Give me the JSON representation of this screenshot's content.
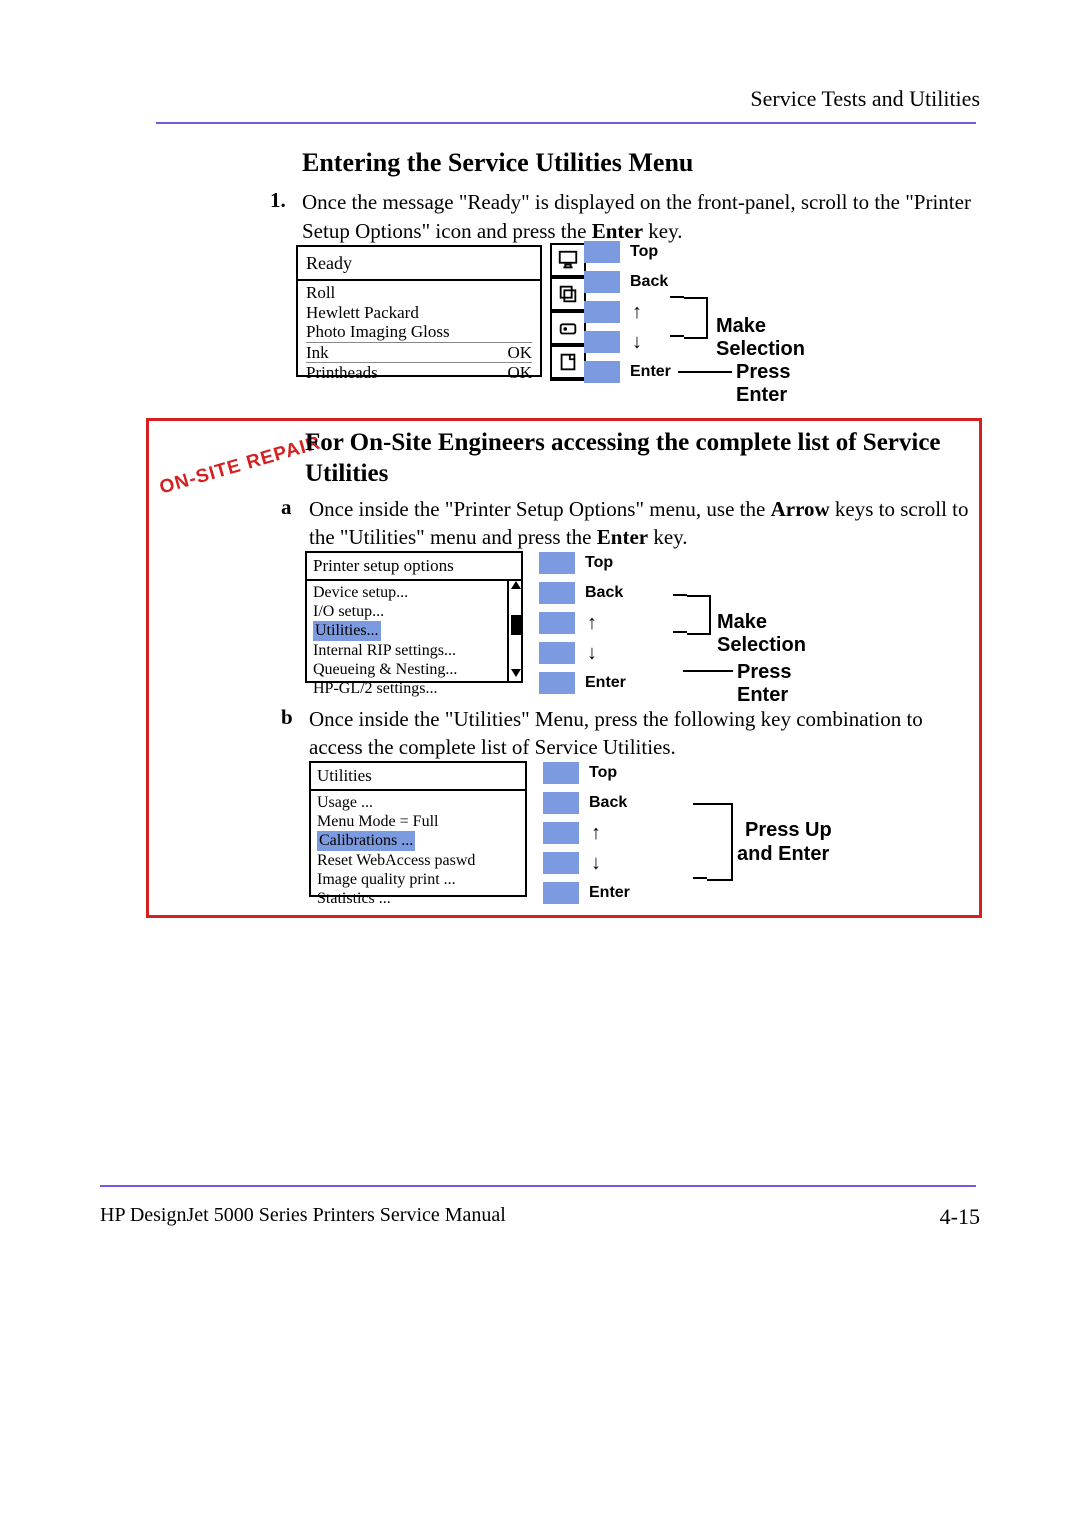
{
  "header": {
    "chapter": "Service Tests and Utilities"
  },
  "section_title": "Entering the Service Utilities Menu",
  "step1": {
    "num": "1.",
    "text_a": "Once the message \"Ready\" is displayed on the front-panel, scroll to the \"Printer Setup Options\" icon and press the ",
    "text_b": "Enter",
    "text_c": " key."
  },
  "lcd1": {
    "top": "Ready",
    "l1": "Roll",
    "l2": "Hewlett Packard",
    "l3": "Photo Imaging Gloss",
    "l4a": "Ink",
    "l4b": "OK",
    "l5a": "Printheads",
    "l5b": "OK"
  },
  "icons": {
    "i1": "monitor-icon",
    "i2": "layers-icon",
    "i3": "cart-icon",
    "i4": "page-icon"
  },
  "keys": {
    "top": "Top",
    "back": "Back",
    "up": "↑",
    "down": "↓",
    "enter": "Enter",
    "make_selection": "Make Selection",
    "press_enter": "Press Enter",
    "press_up": "Press Up",
    "and_enter": "and Enter"
  },
  "redbox": {
    "stamp": "ON-SITE REPAIR",
    "title": "For On-Site Engineers accessing the complete list of Service Utilities",
    "step_a_num": "a",
    "step_a_1": "Once inside the \"Printer Setup Options\" menu, use the ",
    "step_a_2": "Arrow",
    "step_a_3": " keys to scroll to the \"Utilities\" menu and press the ",
    "step_a_4": "Enter",
    "step_a_5": " key.",
    "step_b_num": "b",
    "step_b": "Once inside the \"Utilities\" Menu, press the following key combination to access the complete list of Service Utilities."
  },
  "lcd2": {
    "top": "Printer setup options",
    "l1": "Device setup...",
    "l2": "I/O setup...",
    "l3": "Utilities...",
    "l4": "Internal RIP settings...",
    "l5": "Queueing & Nesting...",
    "l6": "HP-GL/2 settings..."
  },
  "lcd3": {
    "top": "Utilities",
    "l1": "Usage ...",
    "l2": "Menu Mode = Full",
    "l3": "Calibrations ...",
    "l4": "Reset WebAccess paswd",
    "l5": "Image quality print ...",
    "l6": "Statistics ..."
  },
  "footer": {
    "left": "HP DesignJet 5000 Series Printers Service Manual",
    "right": "4-15"
  }
}
